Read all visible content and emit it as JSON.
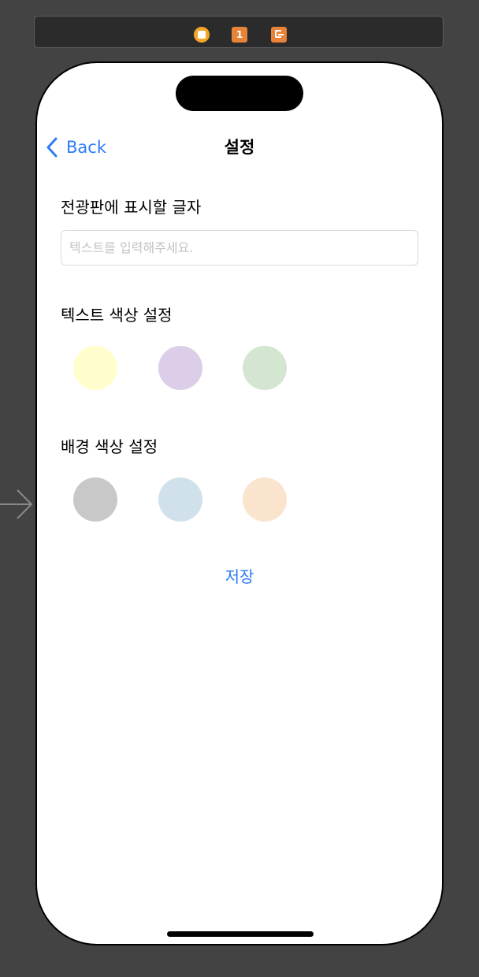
{
  "scene_dock": {
    "icons": [
      "view-controller-icon",
      "first-responder-icon",
      "exit-icon"
    ],
    "first_responder_label": "1"
  },
  "nav": {
    "back_label": "Back",
    "title": "설정"
  },
  "display_text": {
    "label": "전광판에 표시할 글자",
    "placeholder": "텍스트를 입력해주세요.",
    "value": ""
  },
  "text_color": {
    "label": "텍스트 색상 설정",
    "swatches": [
      "#fffecc",
      "#dccde8",
      "#d4e5d1"
    ]
  },
  "background_color": {
    "label": "배경 색상 설정",
    "swatches": [
      "#c8c8c8",
      "#d0e1ec",
      "#fbe4ce"
    ]
  },
  "save_button": {
    "label": "저장"
  },
  "colors": {
    "canvas_background": "#434343",
    "accent": "#2f7cf6",
    "dock_icon_orange": "#e8833a",
    "dock_icon_yellow": "#f4a62a"
  }
}
